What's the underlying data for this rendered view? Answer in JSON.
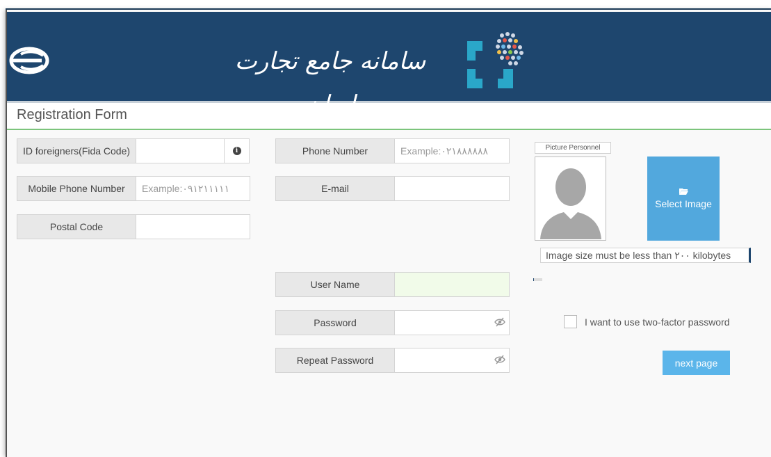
{
  "header": {
    "brand_text": "سامانه جامع تجارت ایران",
    "colors": {
      "header_bg": "#1e466e",
      "accent_green": "#7cc47c",
      "button_blue": "#52a8dd"
    }
  },
  "form": {
    "title": "Registration Form",
    "fida_code": {
      "label": "ID foreigners(Fida Code)",
      "value": "",
      "icon": "info-icon"
    },
    "mobile_phone": {
      "label": "Mobile Phone Number",
      "placeholder": "Example:۰۹۱۲۱۱۱۱۱"
    },
    "postal_code": {
      "label": "Postal Code",
      "value": ""
    },
    "phone_number": {
      "label": "Phone Number",
      "placeholder": "Example:۰۲۱۸۸۸۸۸۸"
    },
    "email": {
      "label": "E-mail",
      "value": ""
    },
    "user_name": {
      "label": "User Name",
      "value": ""
    },
    "password": {
      "label": "Password",
      "value": "",
      "icon": "eye-slash-icon"
    },
    "repeat_password": {
      "label": "Repeat Password",
      "value": "",
      "icon": "eye-slash-icon"
    }
  },
  "picture": {
    "label": "Picture Personnel",
    "select_button": "Select Image",
    "size_note": "Image size must be less than ۲۰۰ kilobytes",
    "upload_progress": 0.1
  },
  "two_factor": {
    "label": "I want to use two-factor password",
    "checked": false
  },
  "next_button": "next page"
}
